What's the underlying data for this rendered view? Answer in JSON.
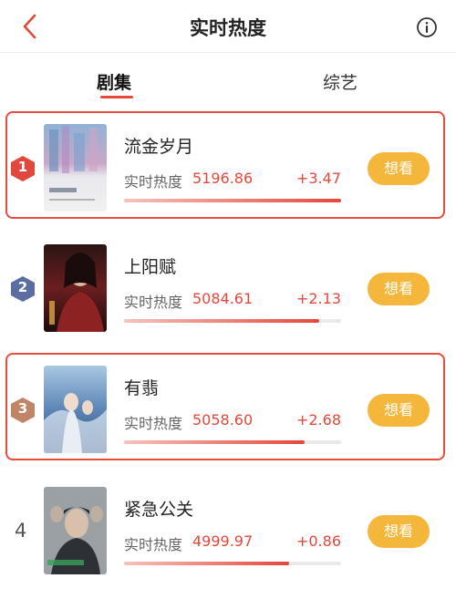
{
  "header": {
    "title": "实时热度"
  },
  "tabs": [
    {
      "label": "剧集",
      "active": true
    },
    {
      "label": "综艺",
      "active": false
    }
  ],
  "colors": {
    "accent": "#e5473b",
    "want_button": "#f5b73b",
    "highlight_border": "#e74c3c"
  },
  "list": [
    {
      "rank": "1",
      "name": "流金岁月",
      "heat_label": "实时热度",
      "heat": "5196.86",
      "change": "+3.47",
      "progress": 1.0,
      "highlighted": true,
      "button": "想看",
      "badge_color": "#e0473d"
    },
    {
      "rank": "2",
      "name": "上阳赋",
      "heat_label": "实时热度",
      "heat": "5084.61",
      "change": "+2.13",
      "progress": 0.9,
      "highlighted": false,
      "button": "想看",
      "badge_color": "#5b6ea1"
    },
    {
      "rank": "3",
      "name": "有翡",
      "heat_label": "实时热度",
      "heat": "5058.60",
      "change": "+2.68",
      "progress": 0.83,
      "highlighted": true,
      "button": "想看",
      "badge_color": "#c08466"
    },
    {
      "rank": "4",
      "name": "紧急公关",
      "heat_label": "实时热度",
      "heat": "4999.97",
      "change": "+0.86",
      "progress": 0.76,
      "highlighted": false,
      "button": "想看"
    }
  ]
}
